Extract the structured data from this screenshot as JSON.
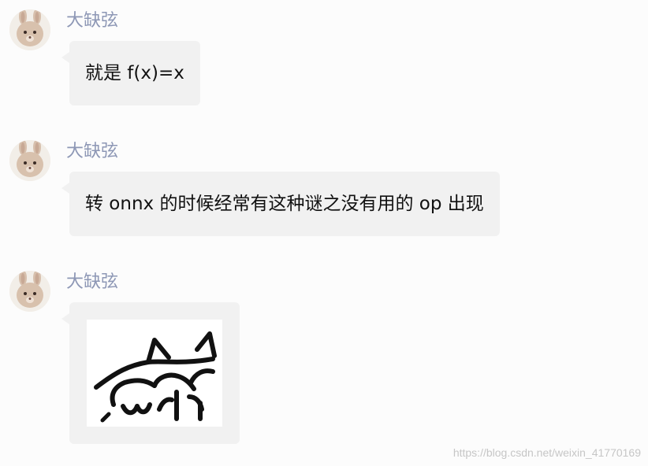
{
  "messages": [
    {
      "sender": "大缺弦",
      "text": "就是 f(x)=x",
      "avatar_icon": "bunny-avatar-icon"
    },
    {
      "sender": "大缺弦",
      "text": "转 onnx 的时候经常有这种谜之没有用的 op 出现",
      "avatar_icon": "bunny-avatar-icon"
    },
    {
      "sender": "大缺弦",
      "image": "cat-sticker",
      "avatar_icon": "bunny-avatar-icon"
    }
  ],
  "watermark": "https://blog.csdn.net/weixin_41770169",
  "colors": {
    "background": "#fcfcfc",
    "bubble": "#f1f1f1",
    "sender": "#8d97b5",
    "text": "#111111",
    "watermark": "#c6c6c6"
  }
}
